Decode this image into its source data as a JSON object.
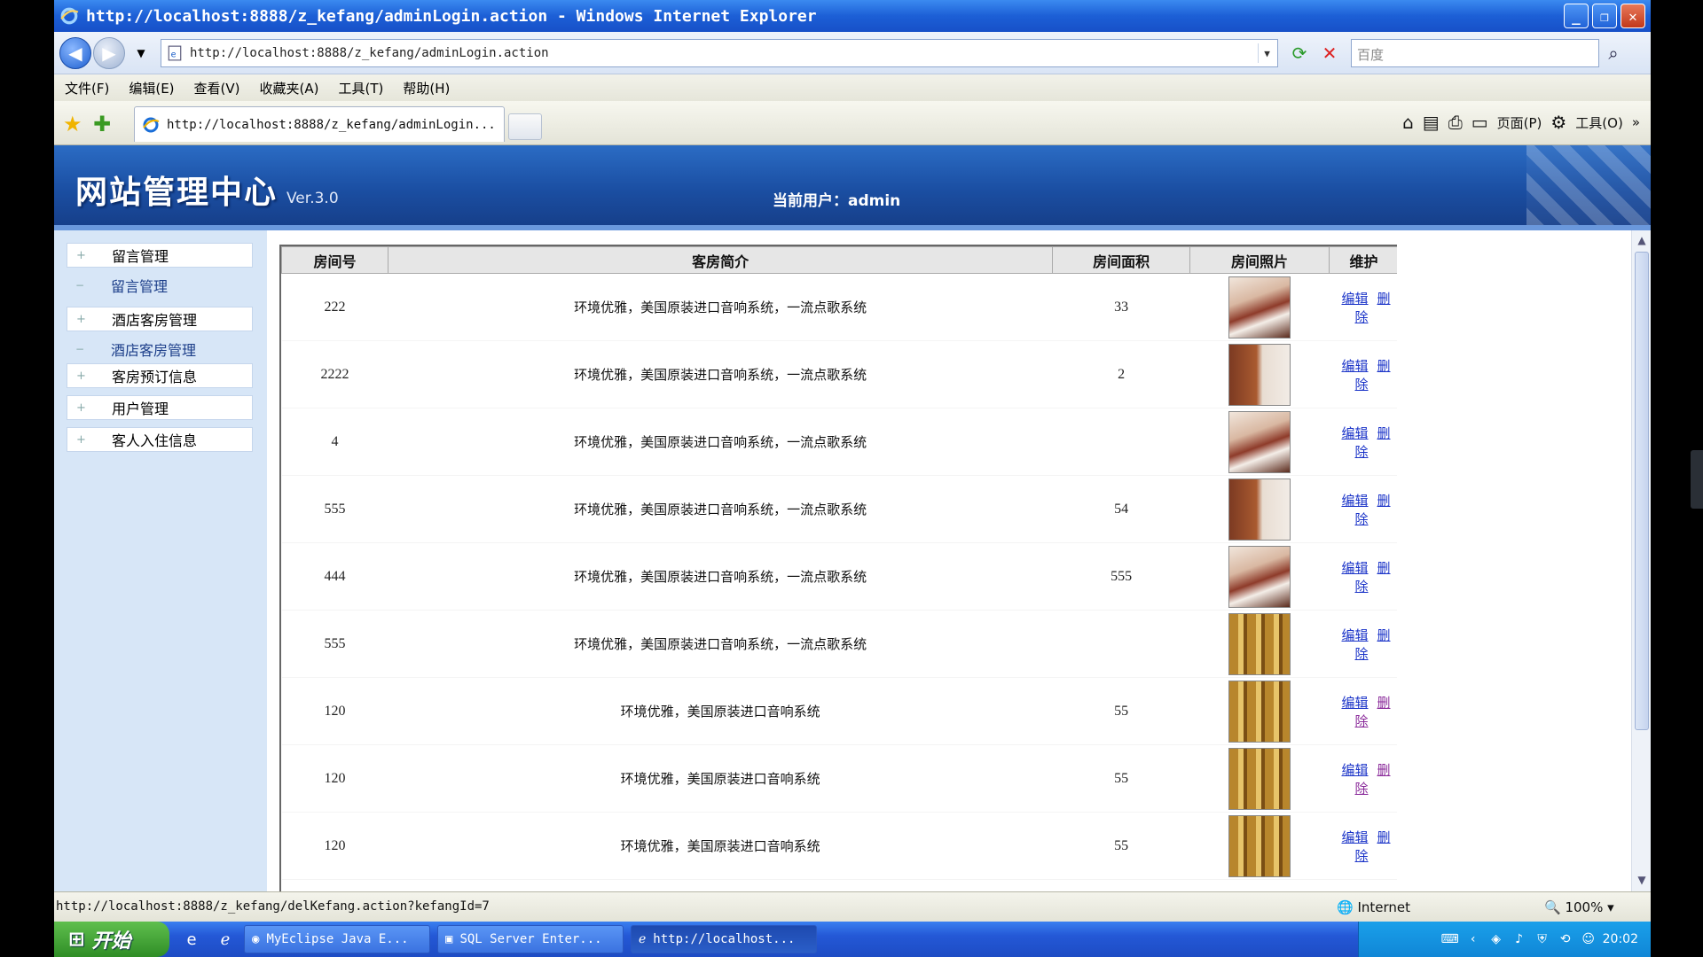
{
  "window": {
    "title": "http://localhost:8888/z_kefang/adminLogin.action - Windows Internet Explorer",
    "address": "http://localhost:8888/z_kefang/adminLogin.action",
    "search_placeholder": "百度",
    "tab_title": "http://localhost:8888/z_kefang/adminLogin..."
  },
  "menu": [
    "文件(F)",
    "编辑(E)",
    "查看(V)",
    "收藏夹(A)",
    "工具(T)",
    "帮助(H)"
  ],
  "toolbar": {
    "page_label": "页面(P)",
    "tools_label": "工具(O)"
  },
  "site": {
    "title": "网站管理中心",
    "version": "Ver.3.0",
    "current_user": "当前用户：admin"
  },
  "sidebar": [
    {
      "label": "留言管理",
      "kind": "group"
    },
    {
      "label": "留言管理",
      "kind": "sub"
    },
    {
      "label": "酒店客房管理",
      "kind": "group"
    },
    {
      "label": "酒店客房管理",
      "kind": "sub"
    },
    {
      "label": "客房预订信息",
      "kind": "group"
    },
    {
      "label": "用户管理",
      "kind": "group"
    },
    {
      "label": "客人入住信息",
      "kind": "group"
    }
  ],
  "table": {
    "columns": [
      "房间号",
      "客房简介",
      "房间面积",
      "房间照片",
      "维护"
    ],
    "edit_label": "编辑",
    "delete_label": "删除",
    "rows": [
      {
        "room": "222",
        "desc": "环境优雅，美国原装进口音响系统，一流点歌系统",
        "area": "33",
        "photo": "red"
      },
      {
        "room": "2222",
        "desc": "环境优雅，美国原装进口音响系统，一流点歌系统",
        "area": "2",
        "photo": "door"
      },
      {
        "room": "4",
        "desc": "环境优雅，美国原装进口音响系统，一流点歌系统",
        "area": "",
        "photo": "red"
      },
      {
        "room": "555",
        "desc": "环境优雅，美国原装进口音响系统，一流点歌系统",
        "area": "54",
        "photo": "door"
      },
      {
        "room": "444",
        "desc": "环境优雅，美国原装进口音响系统，一流点歌系统",
        "area": "555",
        "photo": "red"
      },
      {
        "room": "555",
        "desc": "环境优雅，美国原装进口音响系统，一流点歌系统",
        "area": "",
        "photo": "gold"
      },
      {
        "room": "120",
        "desc": "环境优雅，美国原装进口音响系统",
        "area": "55",
        "photo": "gold"
      },
      {
        "room": "120",
        "desc": "环境优雅，美国原装进口音响系统",
        "area": "55",
        "photo": "gold"
      },
      {
        "room": "120",
        "desc": "环境优雅，美国原装进口音响系统",
        "area": "55",
        "photo": "gold"
      }
    ]
  },
  "status": {
    "url": "http://localhost:8888/z_kefang/delKefang.action?kefangId=7",
    "zone": "Internet",
    "zoom": "100%"
  },
  "taskbar": {
    "start_label": "开始",
    "tasks": [
      "MyEclipse Java E...",
      "SQL Server Enter...",
      "http://localhost..."
    ],
    "clock": "20:02"
  }
}
